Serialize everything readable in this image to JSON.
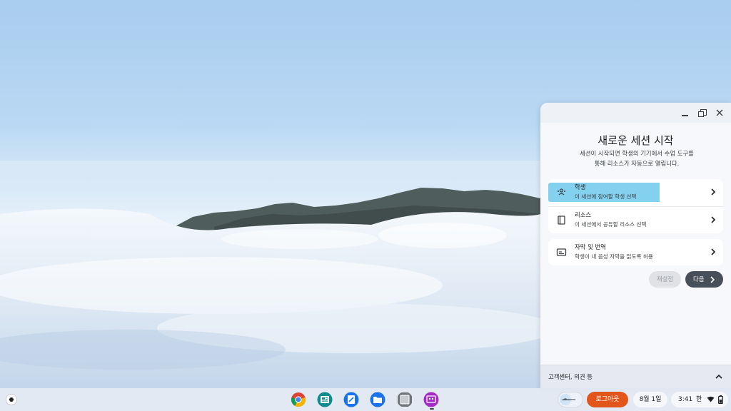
{
  "panel": {
    "title": "새로운 세션 시작",
    "description": "세션이 시작되면 학생의 기기에서 수업 도구를 통해 리소스가 자동으로 열립니다.",
    "items": [
      {
        "title": "학생",
        "subtitle": "이 세션에 참여할 학생 선택",
        "icon": "students-icon"
      },
      {
        "title": "리소스",
        "subtitle": "이 세션에서 공유할 리소스 선택",
        "icon": "book-icon"
      },
      {
        "title": "자막 및 번역",
        "subtitle": "학생이 내 음성 자막을 읽도록 허용",
        "icon": "captions-icon"
      }
    ],
    "reset_label": "재설정",
    "next_label": "다음",
    "footer_label": "고객센터, 의견 등"
  },
  "shelf": {
    "apps": [
      "chrome-icon",
      "classroom-icon",
      "pen-app-icon",
      "files-icon",
      "screen-capture-icon",
      "class-tools-icon"
    ],
    "logout_label": "로그아웃",
    "date": "8월 1일",
    "time": "3:41",
    "ime": "한"
  },
  "colors": {
    "accent_highlight": "#84d1ef",
    "logout": "#e3561b",
    "next_button": "#474f5a"
  }
}
